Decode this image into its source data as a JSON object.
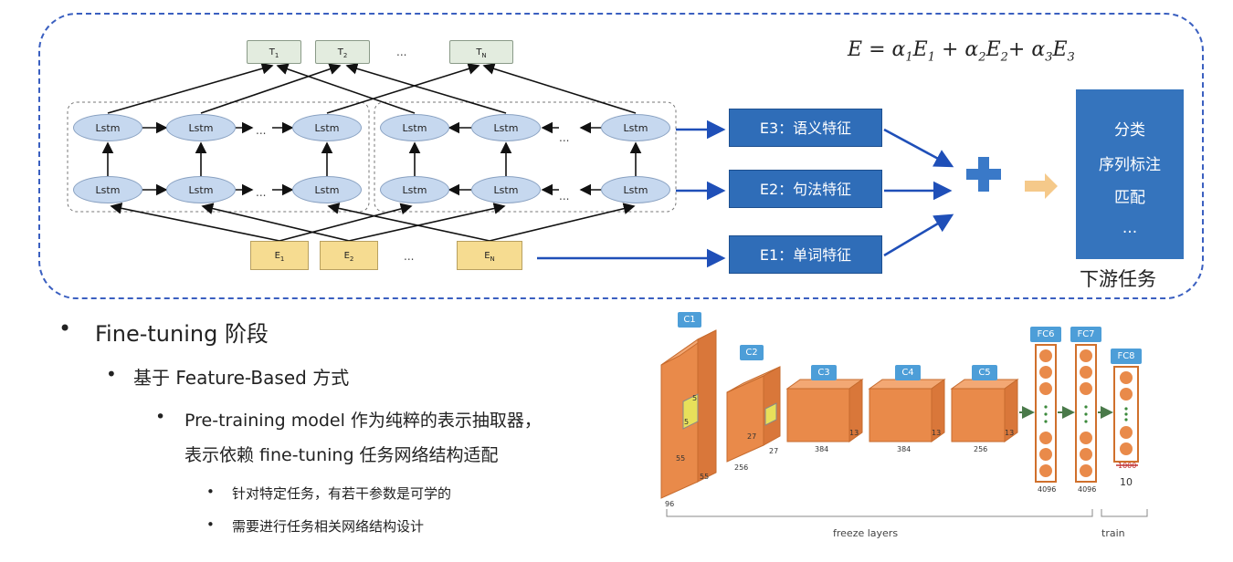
{
  "formula": {
    "lhs": "E",
    "eq": "=",
    "a1": "α",
    "s1": "1",
    "e1": "E",
    "es1": "1",
    "plus1": "+",
    "a2": "α",
    "s2": "2",
    "e2": "E",
    "es2": "2",
    "plus2": "+",
    "a3": "α",
    "s3": "3",
    "e3": "E",
    "es3": "3"
  },
  "outputs": [
    {
      "letter": "T",
      "sub": "1"
    },
    {
      "letter": "T",
      "sub": "2"
    },
    {
      "letter": "T",
      "sub": "N"
    }
  ],
  "outputs_ellipsis": "...",
  "inputs": [
    {
      "letter": "E",
      "sub": "1"
    },
    {
      "letter": "E",
      "sub": "2"
    },
    {
      "letter": "E",
      "sub": "N"
    }
  ],
  "inputs_ellipsis": "...",
  "lstm_label": "Lstm",
  "lstm_ellipsis": "...",
  "features": [
    {
      "label": "E3：语义特征"
    },
    {
      "label": "E2：句法特征"
    },
    {
      "label": "E1：单词特征"
    }
  ],
  "tasks": [
    "分类",
    "序列标注",
    "匹配",
    "..."
  ],
  "task_caption": "下游任务",
  "bullets": {
    "l1": "Fine-tuning 阶段",
    "l2": "基于 Feature-Based 方式",
    "l3a": "Pre-training model 作为纯粹的表示抽取器，",
    "l3b": "表示依赖 fine-tuning 任务网络结构适配",
    "l4a": "针对特定任务，有若干参数是可学的",
    "l4b": "需要进行任务相关网络结构设计",
    "marker": "•"
  },
  "cnn": {
    "layers": [
      "C1",
      "C2",
      "C3",
      "C4",
      "C5",
      "FC6",
      "FC7",
      "FC8"
    ],
    "c1_dims": [
      "55",
      "55",
      "96",
      "5",
      "5"
    ],
    "c2_dims": [
      "27",
      "27",
      "256"
    ],
    "c3_dims": [
      "13",
      "384"
    ],
    "c4_dims": [
      "13",
      "384"
    ],
    "c5_dims": [
      "13",
      "256"
    ],
    "fc6_size": "4096",
    "fc7_size": "4096",
    "fc8_size_crossed": "1000",
    "fc8_size": "10",
    "freeze_label": "freeze layers",
    "train_label": "train"
  },
  "colors": {
    "frame": "#3a5fc0",
    "feature_box": "#2f6db8",
    "task_panel": "#3574bd",
    "lstm": "#c6d8ef",
    "input_box": "#f6dc91",
    "output_box": "#e3ecdf",
    "cnn_block": "#e98a4a",
    "cnn_tag": "#4d9ed8"
  }
}
